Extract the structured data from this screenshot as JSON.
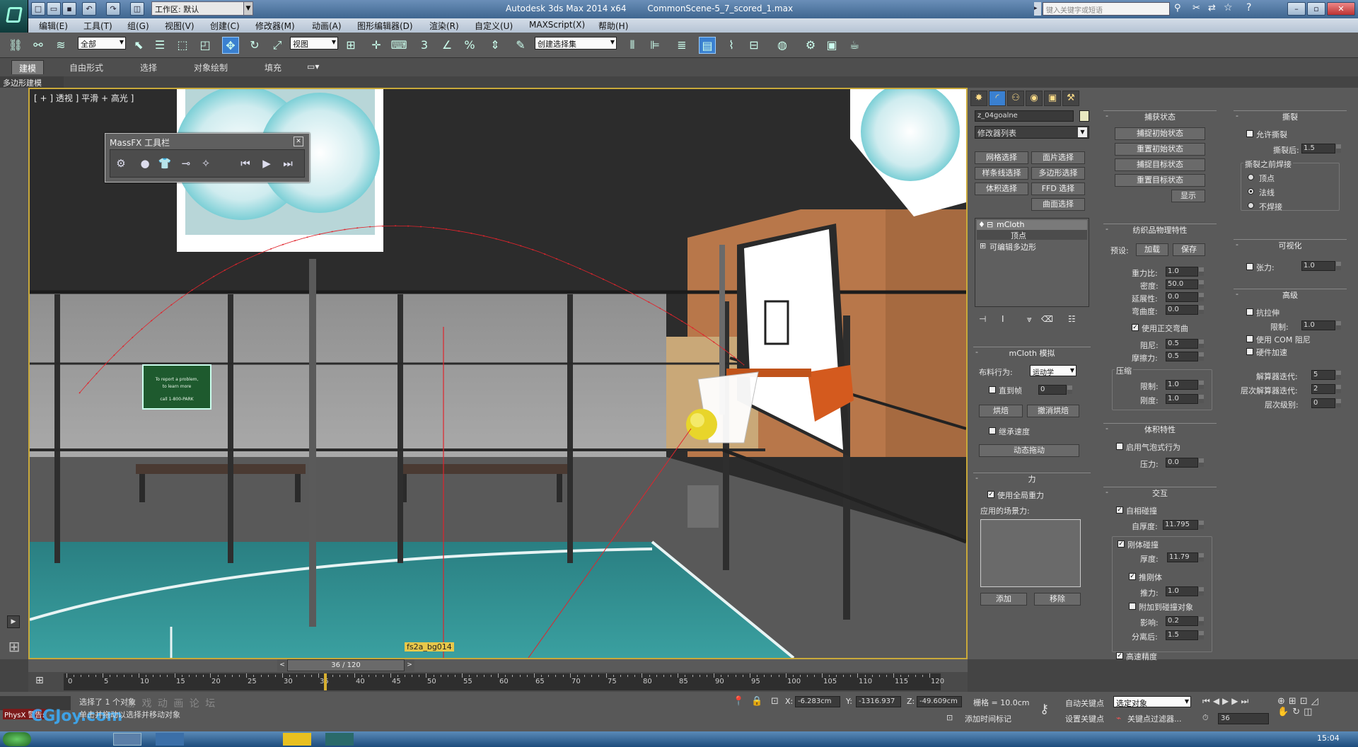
{
  "titlebar": {
    "workspace": "工作区: 默认",
    "app_title": "Autodesk 3ds Max  2014 x64",
    "file_name": "CommonScene-5_7_scored_1.max",
    "search_placeholder": "键入关键字或短语"
  },
  "menu": [
    "编辑(E)",
    "工具(T)",
    "组(G)",
    "视图(V)",
    "创建(C)",
    "修改器(M)",
    "动画(A)",
    "图形编辑器(D)",
    "渲染(R)",
    "自定义(U)",
    "MAXScript(X)",
    "帮助(H)"
  ],
  "toolbar": {
    "filter": "全部",
    "ref_coord": "视图",
    "selection_set": "创建选择集",
    "snap3": "3",
    "snap_angle": "∠",
    "snap_pct": "%"
  },
  "ribbon": {
    "tabs": [
      "建模",
      "自由形式",
      "选择",
      "对象绘制",
      "填充"
    ],
    "sub": "多边形建模"
  },
  "viewport": {
    "label": "[ + ] 透视 ] 平滑 + 高光 ]",
    "object_label": "fs2a_bg014",
    "sign_text": "To report a problem, to learn more call 1-800-PARK",
    "massfx_title": "MassFX 工具栏",
    "massfx_close": "✕"
  },
  "panel": {
    "object_name": "z_04goalne",
    "modifier_list": "修改器列表",
    "sel_buttons": [
      "网格选择",
      "面片选择",
      "样条线选择",
      "多边形选择",
      "体积选择",
      "FFD 选择",
      "曲面选择"
    ],
    "stack": [
      "mCloth",
      "顶点",
      "可编辑多边形"
    ],
    "sim_header": "mCloth 模拟",
    "cloth_behavior_label": "布料行为:",
    "cloth_behavior": "运动学",
    "direct_to": "直到帧",
    "direct_to_val": "0",
    "bake": "烘焙",
    "unbake": "撤消烘焙",
    "inherit_vel": "继承速度",
    "dynamic_drag": "动态拖动",
    "force_header": "力",
    "use_global_gravity": "使用全局重力",
    "applied_forces": "应用的场景力:",
    "add": "添加",
    "remove": "移除",
    "capture_header": "捕获状态",
    "capture_buttons": [
      "捕捉初始状态",
      "重置初始状态",
      "捕捉目标状态",
      "重置目标状态"
    ],
    "show": "显示",
    "textile_header": "纺织品物理特性",
    "preset_label": "预设:",
    "load": "加载",
    "save": "保存",
    "textile_fields": [
      {
        "label": "重力比:",
        "value": "1.0"
      },
      {
        "label": "密度:",
        "value": "50.0"
      },
      {
        "label": "延展性:",
        "value": "0.0"
      },
      {
        "label": "弯曲度:",
        "value": "0.0"
      }
    ],
    "orthogonal_bend": "使用正交弯曲",
    "damping_fields": [
      {
        "label": "阻尼:",
        "value": "0.5"
      },
      {
        "label": "摩擦力:",
        "value": "0.5"
      }
    ],
    "compress_label": "压缩",
    "compress_fields": [
      {
        "label": "限制:",
        "value": "1.0"
      },
      {
        "label": "刚度:",
        "value": "1.0"
      }
    ],
    "volume_header": "体积特性",
    "balloon": "启用气泡式行为",
    "pressure_label": "压力:",
    "pressure": "0.0",
    "interact_header": "交互",
    "self_collision": "自相碰撞",
    "self_thickness_label": "自厚度:",
    "self_thickness": "11.795",
    "rigid_collision": "刚体碰撞",
    "thickness_label": "厚度:",
    "thickness": "11.79",
    "push_rigid": "推刚体",
    "push_label": "推力:",
    "push": "1.0",
    "attach": "附加到碰撞对象",
    "influence_label": "影响:",
    "influence": "0.2",
    "detach_label": "分离后:",
    "detach": "1.5",
    "hi_precision": "高速精度",
    "tear_header": "撕裂",
    "allow_tear": "允许撕裂",
    "tear_after_label": "撕裂后:",
    "tear_after": "1.5",
    "weld_label": "撕裂之前焊接",
    "weld_options": [
      "顶点",
      "法线",
      "不焊接"
    ],
    "vis_header": "可视化",
    "tension": "张力:",
    "tension_val": "1.0",
    "adv_header": "高级",
    "anti_stretch": "抗拉伸",
    "limit_label": "限制:",
    "limit": "1.0",
    "use_com": "使用 COM 阻尼",
    "hw_accel": "硬件加速",
    "solver_iter_label": "解算器迭代:",
    "solver_iter": "5",
    "hier_iter_label": "层次解算器迭代:",
    "hier_iter": "2",
    "hier_levels_label": "层次级别:",
    "hier_levels": "0"
  },
  "timeline": {
    "frame_display": "36 / 120",
    "ticks": [
      "0",
      "5",
      "10",
      "15",
      "20",
      "25",
      "30",
      "35",
      "40",
      "45",
      "50",
      "55",
      "60",
      "65",
      "70",
      "75",
      "80",
      "85",
      "90",
      "95",
      "100",
      "105",
      "110",
      "115",
      "120"
    ],
    "current_frame": 36,
    "max_frame": 120
  },
  "status": {
    "prompt": "选择了 1 个对象",
    "hint": "单击并拖动以选择并移动对象",
    "x_label": "X:",
    "x": "-6.283cm",
    "y_label": "Y:",
    "y": "-1316.937",
    "z_label": "Z:",
    "z": "-49.609cm",
    "grid": "栅格 = 10.0cm",
    "add_time_tag": "添加时间标记",
    "auto_key": "自动关键点",
    "set_key": "设置关键点",
    "selected": "选定对象",
    "key_filter": "关键点过滤器...",
    "frame": "36",
    "time": "15:04",
    "script_label": "PhysX 警告:",
    "watermark": "CGJoy.com",
    "watermark_sub": "游 戏 动 画 论 坛"
  },
  "colors": {
    "viewport_border": "#c9a93a",
    "trajectory": "#e0242c",
    "court": "#2f8a8a"
  }
}
